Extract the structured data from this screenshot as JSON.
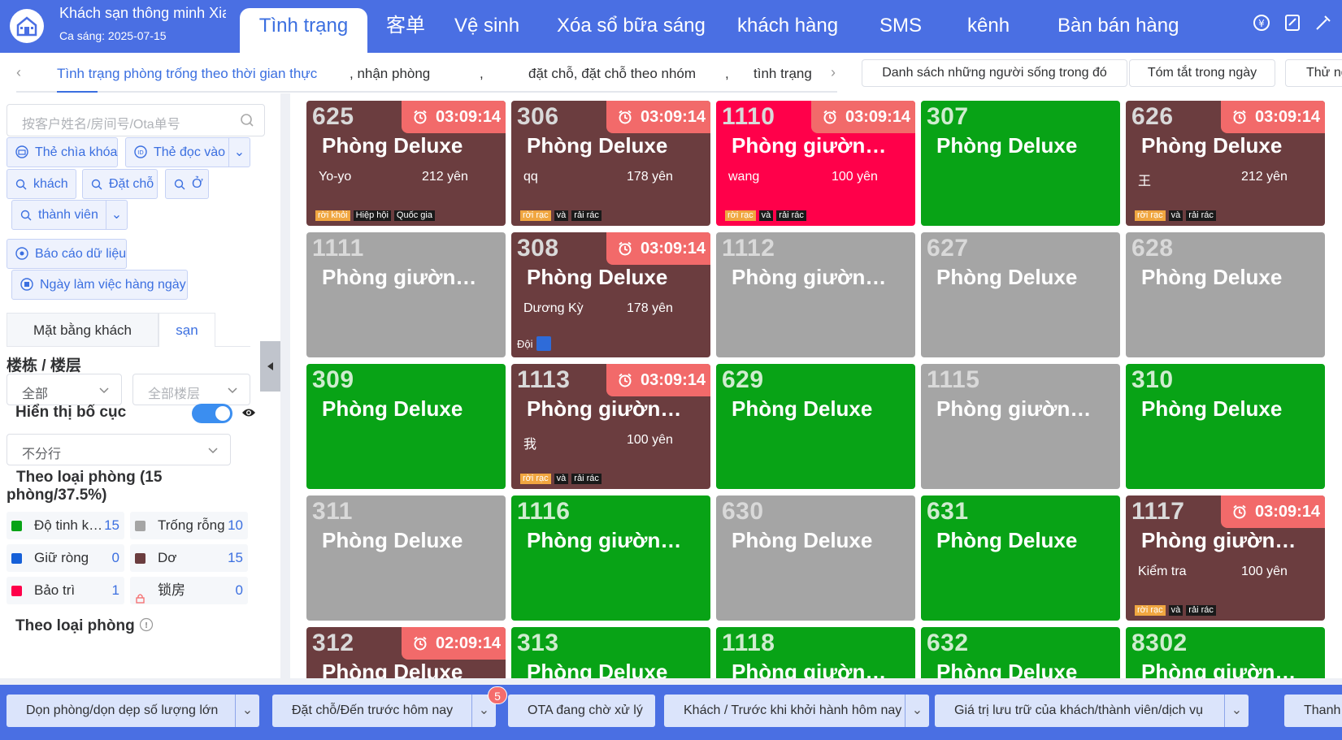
{
  "header": {
    "hotel_name": "Khách sạn thông minh Xia",
    "shift": "Ca sáng: 2025-07-15",
    "nav": [
      "Tình trạng",
      "客单",
      "Vệ sinh",
      "Xóa sổ bữa sáng",
      "khách hàng",
      "SMS",
      "kênh",
      "Bàn bán hàng"
    ],
    "active_nav": "Tình trạng"
  },
  "subtabs": {
    "items": [
      "Tình trạng phòng trống theo thời gian thực",
      ", nhận phòng",
      ",",
      "đặt chỗ, đặt chỗ theo nhóm",
      ",",
      "tình trạng"
    ],
    "buttons": [
      "Danh sách những người sống trong đó",
      "Tóm tắt trong ngày",
      "Thử ng"
    ]
  },
  "sidebar": {
    "search_placeholder": "按客户姓名/房间号/Ota单号",
    "chips": {
      "key_card": "Thẻ chìa khóa",
      "read_card": "Thẻ đọc vào",
      "guest": "khách",
      "booking": "Đặt chỗ",
      "stay": "Ở",
      "member": "thành viên",
      "report": "Báo cáo dữ liệu",
      "workday": "Ngày làm việc hàng ngày"
    },
    "tab_plan": "Mặt bằng khách",
    "tab_other": "sạn",
    "building_title": "楼栋 / 楼层",
    "building_select": "全部",
    "floor_select": "全部楼层",
    "layout_label": "Hiển thị bố cục",
    "layout_select": "不分行",
    "by_type_title": "Theo loại phòng (15 phòng/37.5%)",
    "stats": [
      {
        "label": "Độ tinh khiết",
        "count": "15",
        "color": "#08a316"
      },
      {
        "label": "Trống rỗng",
        "count": "10",
        "color": "#a5a5a5"
      },
      {
        "label": "Giữ ròng",
        "count": "0",
        "color": "#1660d8"
      },
      {
        "label": "Dơ",
        "count": "15",
        "color": "#6b3d3f"
      },
      {
        "label": "Bảo trì",
        "count": "1",
        "color": "#ff004a"
      },
      {
        "label": "锁房",
        "count": "0",
        "color": "#f56c6c"
      }
    ],
    "by_type_bottom": "Theo loại phòng"
  },
  "rooms": [
    {
      "no": "625",
      "type": "Phòng Deluxe",
      "status": "brown",
      "timer": "03:09:14",
      "guest": "Yo-yo",
      "price": "212 yên",
      "tags": [
        "rời khỏi",
        "Hiệp hội",
        "Quốc gia"
      ]
    },
    {
      "no": "306",
      "type": "Phòng Deluxe",
      "status": "brown",
      "timer": "03:09:14",
      "guest": "qq",
      "price": "178 yên",
      "tags": [
        "rời rạc",
        "và",
        "rải rác"
      ]
    },
    {
      "no": "1110",
      "type": "Phòng giường đôi",
      "status": "red",
      "timer": "03:09:14",
      "guest": "wang",
      "price": "100 yên",
      "tags": [
        "rời rạc",
        "và",
        "rải rác"
      ]
    },
    {
      "no": "307",
      "type": "Phòng Deluxe",
      "status": "green"
    },
    {
      "no": "626",
      "type": "Phòng Deluxe",
      "status": "brown",
      "timer": "03:09:14",
      "guest": "王",
      "price": "212 yên",
      "tags": [
        "rời rạc",
        "và",
        "rải rác"
      ]
    },
    {
      "no": "1111",
      "type": "Phòng giường đôi",
      "status": "gray"
    },
    {
      "no": "308",
      "type": "Phòng Deluxe",
      "status": "brown",
      "timer": "03:09:14",
      "guest": "Dương Kỳ",
      "price": "178 yên",
      "team": "Đội"
    },
    {
      "no": "1112",
      "type": "Phòng giường đôi",
      "status": "gray"
    },
    {
      "no": "627",
      "type": "Phòng Deluxe",
      "status": "gray"
    },
    {
      "no": "628",
      "type": "Phòng Deluxe",
      "status": "gray"
    },
    {
      "no": "309",
      "type": "Phòng Deluxe",
      "status": "green"
    },
    {
      "no": "1113",
      "type": "Phòng giường đôi",
      "status": "brown",
      "timer": "03:09:14",
      "guest": "我",
      "price": "100 yên",
      "tags": [
        "rời rạc",
        "và",
        "rải rác"
      ]
    },
    {
      "no": "629",
      "type": "Phòng Deluxe",
      "status": "green"
    },
    {
      "no": "1115",
      "type": "Phòng giường đôi",
      "status": "gray"
    },
    {
      "no": "310",
      "type": "Phòng Deluxe",
      "status": "green"
    },
    {
      "no": "311",
      "type": "Phòng Deluxe",
      "status": "gray"
    },
    {
      "no": "1116",
      "type": "Phòng giường đôi",
      "status": "green"
    },
    {
      "no": "630",
      "type": "Phòng Deluxe",
      "status": "gray"
    },
    {
      "no": "631",
      "type": "Phòng Deluxe",
      "status": "green"
    },
    {
      "no": "1117",
      "type": "Phòng giường đôi",
      "status": "brown",
      "timer": "03:09:14",
      "guest": "Kiểm tra",
      "price": "100 yên",
      "tags": [
        "rời rạc",
        "và",
        "rải rác"
      ]
    },
    {
      "no": "312",
      "type": "Phòng Deluxe",
      "status": "brown",
      "timer": "02:09:14"
    },
    {
      "no": "313",
      "type": "Phòng Deluxe",
      "status": "green"
    },
    {
      "no": "1118",
      "type": "Phòng giường đôi",
      "status": "green"
    },
    {
      "no": "632",
      "type": "Phòng Deluxe",
      "status": "green"
    },
    {
      "no": "8302",
      "type": "Phòng giường đôi",
      "status": "green"
    }
  ],
  "bottom": {
    "buttons": [
      "Dọn phòng/dọn dẹp số lượng lớn",
      "Đặt chỗ/Đến trước hôm nay",
      "OTA đang chờ xử lý",
      "Khách / Trước khi khởi hành hôm nay",
      "Giá trị lưu trữ của khách/thành viên/dịch vụ",
      "Thanh"
    ],
    "badge": "5"
  }
}
